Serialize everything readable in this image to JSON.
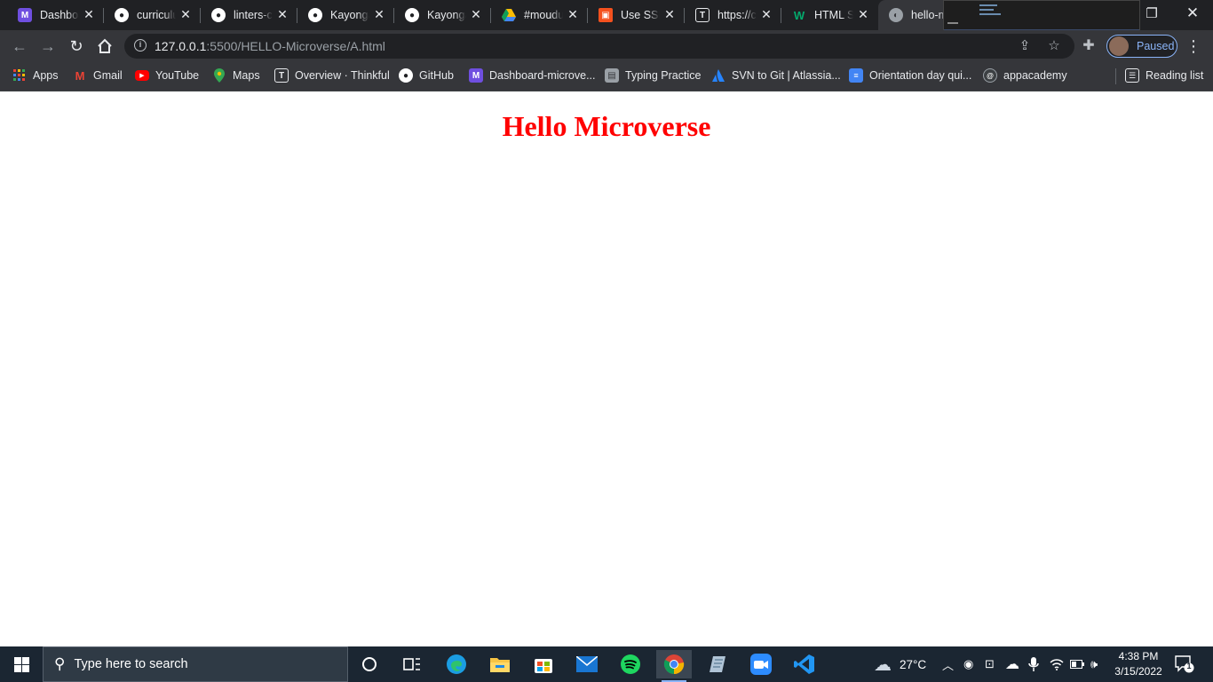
{
  "browser": {
    "tabs": [
      {
        "title": "Dashboard - Microverse",
        "icon": "microverse-icon",
        "color": "#6f4fe0"
      },
      {
        "title": "curriculum",
        "icon": "github-icon",
        "color": "#ffffff"
      },
      {
        "title": "linters-config",
        "icon": "github-icon",
        "color": "#ffffff"
      },
      {
        "title": "Kayonga",
        "icon": "github-icon",
        "color": "#ffffff"
      },
      {
        "title": "Kayonga",
        "icon": "github-icon",
        "color": "#ffffff"
      },
      {
        "title": "#moudule",
        "icon": "google-drive-icon",
        "color": "#fbbc04"
      },
      {
        "title": "Use SSH",
        "icon": "gift-icon",
        "color": "#f4511e"
      },
      {
        "title": "https://c",
        "icon": "thinkful-icon",
        "color": "#ffffff"
      },
      {
        "title": "HTML Sl",
        "icon": "w3-icon",
        "color": "#04aa6d"
      },
      {
        "title": "hello-microverse",
        "icon": "globe-icon",
        "color": "#bdc1c6",
        "active": true
      }
    ],
    "url_host": "127.0.0.1",
    "url_path": ":5500/HELLO-Microverse/A.html",
    "profile_status": "Paused",
    "bookmarks": [
      {
        "label": "Apps",
        "icon": "apps-grid-icon",
        "color": "#ea4335"
      },
      {
        "label": "Gmail",
        "icon": "gmail-icon",
        "color": "#ea4335"
      },
      {
        "label": "YouTube",
        "icon": "youtube-icon",
        "color": "#ff0000"
      },
      {
        "label": "Maps",
        "icon": "maps-pin-icon",
        "color": "#34a853"
      },
      {
        "label": "Overview · Thinkful",
        "icon": "thinkful-icon",
        "color": "#5f6368"
      },
      {
        "label": "GitHub",
        "icon": "github-icon",
        "color": "#ffffff"
      },
      {
        "label": "Dashboard-microve...",
        "icon": "microverse-icon",
        "color": "#6f4fe0"
      },
      {
        "label": "Typing Practice",
        "icon": "keyboard-icon",
        "color": "#9aa0a6"
      },
      {
        "label": "SVN to Git | Atlassia...",
        "icon": "atlassian-icon",
        "color": "#2684ff"
      },
      {
        "label": "Orientation day qui...",
        "icon": "google-docs-icon",
        "color": "#4285f4"
      },
      {
        "label": "appacademy",
        "icon": "appacademy-icon",
        "color": "#3c4043"
      }
    ],
    "reading_list": "Reading list"
  },
  "page": {
    "heading": "Hello Microverse",
    "heading_color": "#ff0000"
  },
  "taskbar": {
    "search_placeholder": "Type here to search",
    "weather": "27°C",
    "time": "4:38 PM",
    "date": "3/15/2022",
    "notification_count": "1"
  }
}
